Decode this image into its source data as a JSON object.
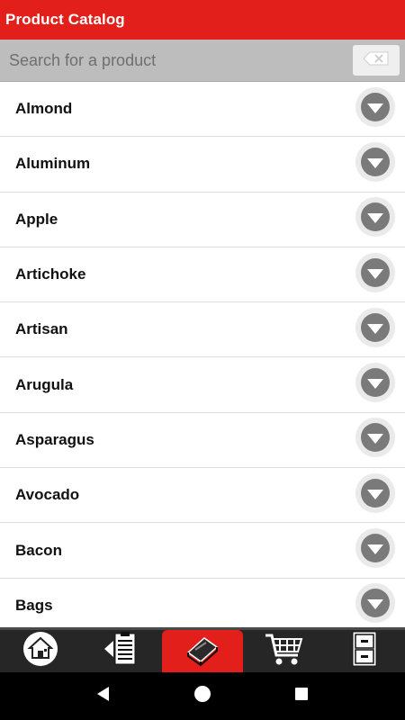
{
  "app": {
    "title": "Product Catalog"
  },
  "search": {
    "placeholder": "Search for a product",
    "value": ""
  },
  "products": [
    {
      "label": "Almond"
    },
    {
      "label": "Aluminum"
    },
    {
      "label": "Apple"
    },
    {
      "label": "Artichoke"
    },
    {
      "label": "Artisan"
    },
    {
      "label": "Arugula"
    },
    {
      "label": "Asparagus"
    },
    {
      "label": "Avocado"
    },
    {
      "label": "Bacon"
    },
    {
      "label": "Bags"
    }
  ],
  "bottom_nav": {
    "tabs": [
      {
        "icon": "home-icon",
        "active": false
      },
      {
        "icon": "order-guide-icon",
        "active": false
      },
      {
        "icon": "catalog-book-icon",
        "active": true
      },
      {
        "icon": "cart-icon",
        "active": false
      },
      {
        "icon": "cabinet-icon",
        "active": false
      }
    ]
  },
  "colors": {
    "accent": "#e21f1b",
    "search_bg": "#bdbdbd",
    "nav_bg": "#262626"
  },
  "system_nav": {
    "icons": [
      "back-icon",
      "home-circle-icon",
      "recents-icon"
    ]
  }
}
